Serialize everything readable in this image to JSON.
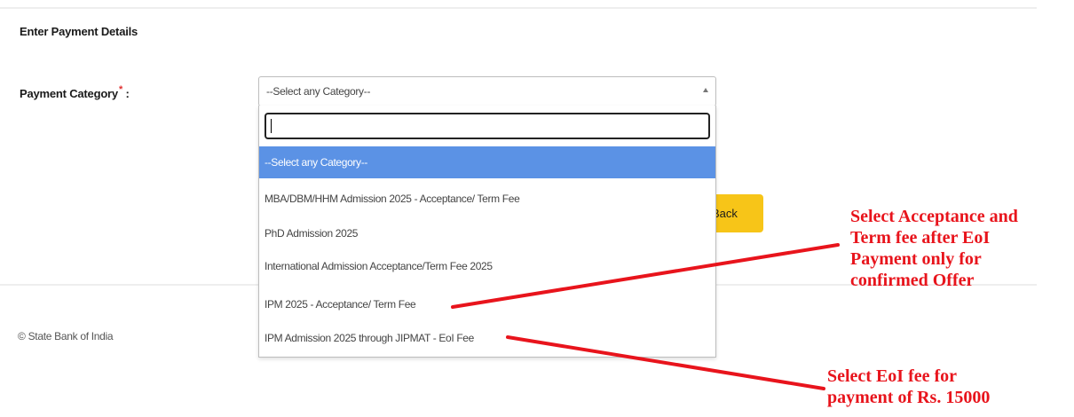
{
  "form": {
    "section_title": "Enter Payment Details",
    "category_label": "Payment Category",
    "required_mark": "*",
    "colon": ":",
    "selected_value": "--Select any Category--",
    "search_value": "",
    "options": [
      "--Select any Category--",
      "MBA/DBM/HHM Admission 2025 - Acceptance/ Term Fee",
      "PhD Admission 2025",
      "International Admission Acceptance/Term Fee 2025",
      "IPM 2025 - Acceptance/ Term Fee",
      "IPM Admission 2025 through JIPMAT - EoI Fee"
    ],
    "back_label": "Back",
    "back_visible_text": "Back"
  },
  "footer": {
    "copyright": "© State Bank of India"
  },
  "annotations": {
    "note1": [
      "Select Acceptance and",
      "Term fee after EoI",
      "Payment only for",
      "confirmed Offer"
    ],
    "note2": [
      "Select EoI fee for",
      "payment of Rs. 15000"
    ]
  },
  "colors": {
    "accent_highlight": "#5b92e5",
    "button": "#f7c518",
    "annotation": "#e8141c"
  }
}
